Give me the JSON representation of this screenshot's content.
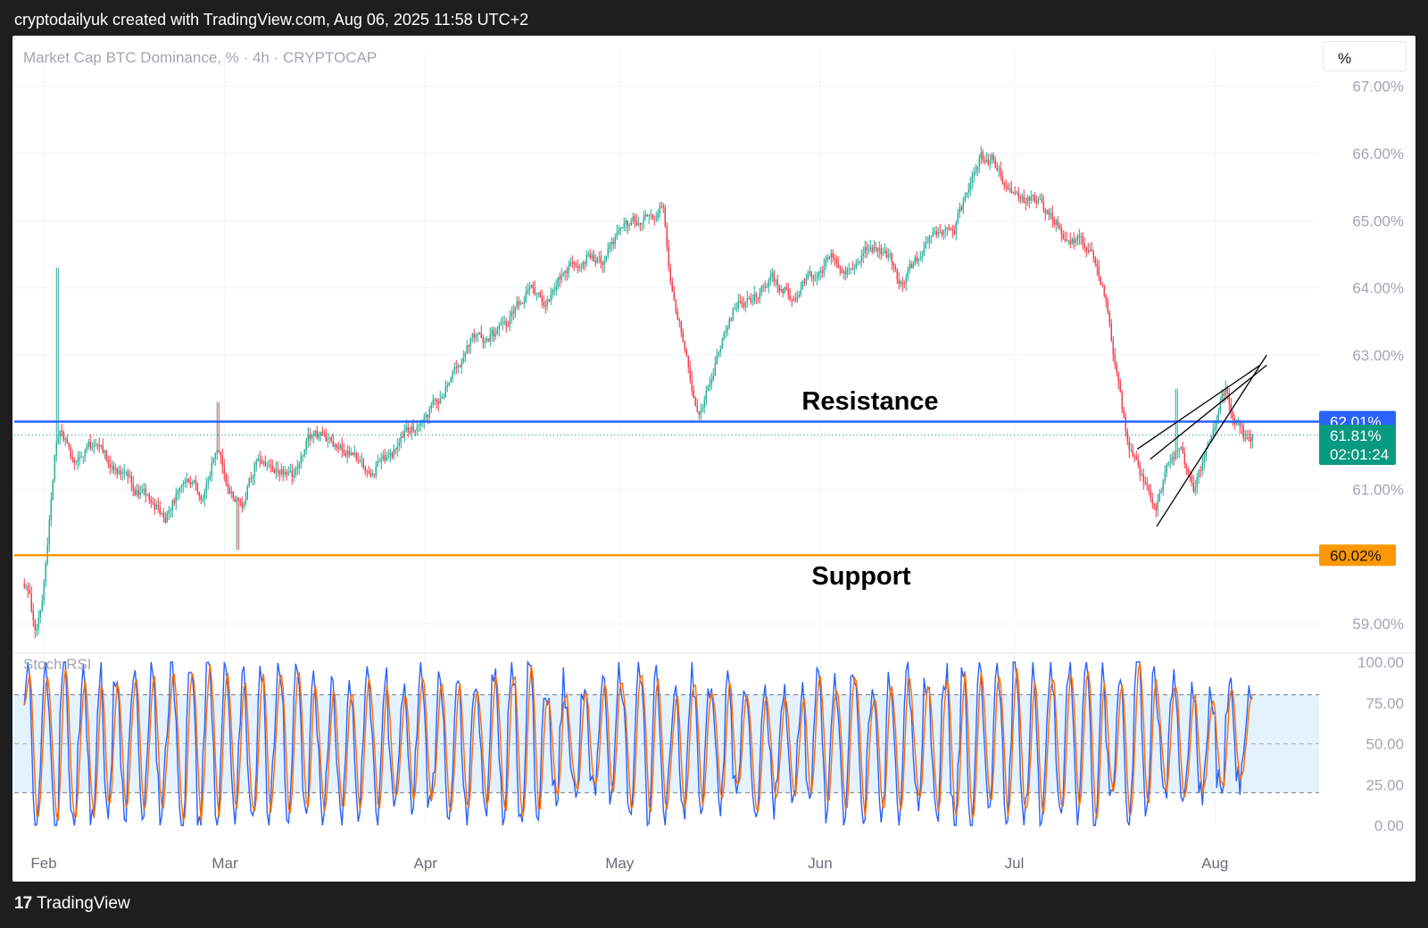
{
  "header": {
    "attribution": "cryptodailyuk created with TradingView.com, Aug 06, 2025 11:58 UTC+2"
  },
  "footer": {
    "logo_mark": "17",
    "logo_text": "TradingView"
  },
  "toolbar": {
    "unit_label": "%"
  },
  "colors": {
    "background": "#ffffff",
    "frame": "#1e1e1e",
    "up_candle": "#22ab94",
    "down_candle": "#f23645",
    "resistance_line": "#2962ff",
    "support_line": "#ff9800",
    "price_tag": "#089981",
    "stoch_k": "#2962ff",
    "stoch_d": "#ff6d00",
    "stoch_band": "#e3f2fd"
  },
  "chart_data": [
    {
      "type": "candlestick",
      "title": "Market Cap BTC Dominance, % · 4h · CRYPTOCAP",
      "y_unit": "%",
      "ylim": [
        58.6,
        67.45
      ],
      "y_ticks": [
        "67.00%",
        "66.00%",
        "65.00%",
        "64.00%",
        "63.00%",
        "61.00%",
        "59.00%"
      ],
      "x_ticks": [
        "Feb",
        "Mar",
        "Apr",
        "May",
        "Jun",
        "Jul",
        "Aug"
      ],
      "grid": true,
      "price_path": [
        [
          "2025-01-28",
          59.6
        ],
        [
          "2025-01-29",
          59.4
        ],
        [
          "2025-01-30",
          58.9
        ],
        [
          "2025-01-31",
          59.4
        ],
        [
          "2025-02-01",
          60.4
        ],
        [
          "2025-02-02",
          61.5
        ],
        [
          "2025-02-03",
          61.9
        ],
        [
          "2025-02-05",
          61.4
        ],
        [
          "2025-02-08",
          61.7
        ],
        [
          "2025-02-12",
          61.2
        ],
        [
          "2025-02-16",
          60.9
        ],
        [
          "2025-02-19",
          60.6
        ],
        [
          "2025-02-22",
          61.1
        ],
        [
          "2025-02-25",
          60.9
        ],
        [
          "2025-02-27",
          61.7
        ],
        [
          "2025-03-01",
          61.0
        ],
        [
          "2025-03-03",
          60.8
        ],
        [
          "2025-03-05",
          61.4
        ],
        [
          "2025-03-08",
          61.3
        ],
        [
          "2025-03-11",
          61.2
        ],
        [
          "2025-03-14",
          61.9
        ],
        [
          "2025-03-17",
          61.6
        ],
        [
          "2025-03-20",
          61.5
        ],
        [
          "2025-03-23",
          61.3
        ],
        [
          "2025-03-26",
          61.5
        ],
        [
          "2025-03-28",
          61.8
        ],
        [
          "2025-03-30",
          62.0
        ],
        [
          "2025-04-02",
          62.3
        ],
        [
          "2025-04-05",
          62.8
        ],
        [
          "2025-04-08",
          63.3
        ],
        [
          "2025-04-10",
          63.2
        ],
        [
          "2025-04-13",
          63.5
        ],
        [
          "2025-04-16",
          64.0
        ],
        [
          "2025-04-19",
          63.8
        ],
        [
          "2025-04-22",
          64.3
        ],
        [
          "2025-04-25",
          64.5
        ],
        [
          "2025-04-28",
          64.4
        ],
        [
          "2025-05-01",
          64.9
        ],
        [
          "2025-05-03",
          65.0
        ],
        [
          "2025-05-05",
          65.0
        ],
        [
          "2025-05-07",
          65.3
        ],
        [
          "2025-05-08",
          64.2
        ],
        [
          "2025-05-10",
          63.3
        ],
        [
          "2025-05-12",
          62.3
        ],
        [
          "2025-05-13",
          62.2
        ],
        [
          "2025-05-15",
          62.9
        ],
        [
          "2025-05-18",
          63.7
        ],
        [
          "2025-05-21",
          63.9
        ],
        [
          "2025-05-24",
          64.1
        ],
        [
          "2025-05-27",
          63.9
        ],
        [
          "2025-05-30",
          64.2
        ],
        [
          "2025-06-02",
          64.4
        ],
        [
          "2025-06-05",
          64.2
        ],
        [
          "2025-06-08",
          64.7
        ],
        [
          "2025-06-11",
          64.5
        ],
        [
          "2025-06-13",
          64.0
        ],
        [
          "2025-06-15",
          64.4
        ],
        [
          "2025-06-18",
          64.8
        ],
        [
          "2025-06-21",
          64.9
        ],
        [
          "2025-06-24",
          65.6
        ],
        [
          "2025-06-25",
          65.9
        ],
        [
          "2025-06-27",
          65.9
        ],
        [
          "2025-06-30",
          65.3
        ],
        [
          "2025-07-03",
          65.3
        ],
        [
          "2025-07-06",
          65.1
        ],
        [
          "2025-07-09",
          64.7
        ],
        [
          "2025-07-12",
          64.6
        ],
        [
          "2025-07-14",
          64.0
        ],
        [
          "2025-07-16",
          62.8
        ],
        [
          "2025-07-18",
          61.6
        ],
        [
          "2025-07-20",
          61.2
        ],
        [
          "2025-07-22",
          60.6
        ],
        [
          "2025-07-24",
          61.3
        ],
        [
          "2025-07-26",
          61.6
        ],
        [
          "2025-07-28",
          61.0
        ],
        [
          "2025-07-30",
          61.6
        ],
        [
          "2025-08-01",
          62.2
        ],
        [
          "2025-08-02",
          62.5
        ],
        [
          "2025-08-03",
          62.2
        ],
        [
          "2025-08-04",
          61.9
        ],
        [
          "2025-08-05",
          61.7
        ],
        [
          "2025-08-06",
          61.8
        ]
      ],
      "spike_highs": [
        [
          "2025-02-02",
          64.3
        ],
        [
          "2025-02-27",
          62.3
        ],
        [
          "2025-07-25",
          62.5
        ]
      ],
      "spike_lows": [
        [
          "2025-03-02",
          60.1
        ]
      ],
      "horizontal_levels": [
        {
          "value": 62.01,
          "label": "62.01%",
          "annotation": "Resistance"
        },
        {
          "value": 60.02,
          "label": "60.02%",
          "annotation": "Support"
        }
      ],
      "current_price": {
        "value": 61.81,
        "label": "61.81%",
        "countdown": "02:01:24"
      },
      "channel_lines": [
        {
          "from": [
            "2025-07-22",
            60.45
          ],
          "to": [
            "2025-08-08",
            63.0
          ]
        },
        {
          "from": [
            "2025-07-19",
            61.6
          ],
          "to": [
            "2025-08-07",
            62.85
          ]
        },
        {
          "from": [
            "2025-07-21",
            61.45
          ],
          "to": [
            "2025-08-08",
            62.85
          ]
        }
      ]
    },
    {
      "type": "line",
      "title": "Stoch RSI",
      "ylim": [
        0,
        100
      ],
      "y_ticks": [
        "100.00",
        "75.00",
        "50.00",
        "25.00",
        "0.00"
      ],
      "levels": [
        80,
        50,
        20
      ],
      "band": [
        20,
        80
      ],
      "last_value": 78,
      "series": [
        {
          "values": []
        },
        {
          "values": []
        }
      ]
    }
  ]
}
